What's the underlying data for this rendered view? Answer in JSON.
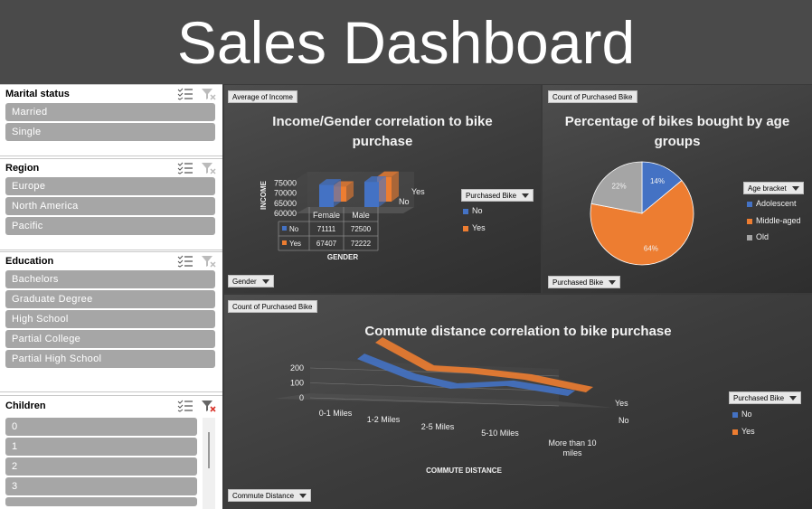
{
  "dashboard": {
    "title": "Sales Dashboard"
  },
  "colors": {
    "no": "#4472c4",
    "yes": "#ed7d31",
    "old": "#a5a5a5"
  },
  "slicers": [
    {
      "label": "Marital status",
      "items": [
        "Married",
        "Single"
      ]
    },
    {
      "label": "Region",
      "items": [
        "Europe",
        "North America",
        "Pacific"
      ]
    },
    {
      "label": "Education",
      "items": [
        "Bachelors",
        "Graduate Degree",
        "High School",
        "Partial College",
        "Partial High School"
      ]
    },
    {
      "label": "Children",
      "items": [
        "0",
        "1",
        "2",
        "3"
      ]
    }
  ],
  "panels": {
    "income": {
      "value_field": "Average of Income",
      "axis_field": "Gender",
      "legend_field": "Purchased Bike",
      "legend": [
        "No",
        "Yes"
      ]
    },
    "age": {
      "value_field": "Count of Purchased Bike",
      "axis_field": "Purchased Bike",
      "legend_field": "Age bracket",
      "legend": [
        "Adolescent",
        "Middle-aged",
        "Old"
      ]
    },
    "commute": {
      "value_field": "Count of Purchased Bike",
      "axis_field": "Commute Distance",
      "legend_field": "Purchased Bike",
      "legend": [
        "No",
        "Yes"
      ]
    }
  },
  "chart_data": [
    {
      "type": "bar",
      "title": "Income/Gender correlation to bike purchase",
      "xlabel": "GENDER",
      "ylabel": "INCOME",
      "categories": [
        "Female",
        "Male"
      ],
      "series": [
        {
          "name": "No",
          "values": [
            71111,
            72500
          ]
        },
        {
          "name": "Yes",
          "values": [
            67407,
            72222
          ]
        }
      ],
      "yticks": [
        "60000",
        "65000",
        "70000",
        "75000"
      ],
      "depth_labels": [
        "Yes",
        "No"
      ],
      "table": {
        "rows": [
          {
            "label": "No",
            "values": [
              "71111",
              "72500"
            ]
          },
          {
            "label": "Yes",
            "values": [
              "67407",
              "72222"
            ]
          }
        ]
      }
    },
    {
      "type": "pie",
      "title": "Percentage of bikes bought by age groups",
      "categories": [
        "Adolescent",
        "Middle-aged",
        "Old"
      ],
      "values": [
        14,
        64,
        22
      ],
      "labels": [
        "14%",
        "64%",
        "22%"
      ]
    },
    {
      "type": "line",
      "title": "Commute distance correlation to bike purchase",
      "xlabel": "COMMUTE DISTANCE",
      "categories": [
        "0-1 Miles",
        "1-2 Miles",
        "2-5 Miles",
        "5-10 Miles",
        "More than 10 miles"
      ],
      "series": [
        {
          "name": "No",
          "values": [
            166,
            92,
            67,
            95,
            78
          ]
        },
        {
          "name": "Yes",
          "values": [
            200,
            77,
            95,
            67,
            33
          ]
        }
      ],
      "yticks": [
        "0",
        "100",
        "200"
      ],
      "depth_labels": [
        "Yes",
        "No"
      ]
    }
  ]
}
